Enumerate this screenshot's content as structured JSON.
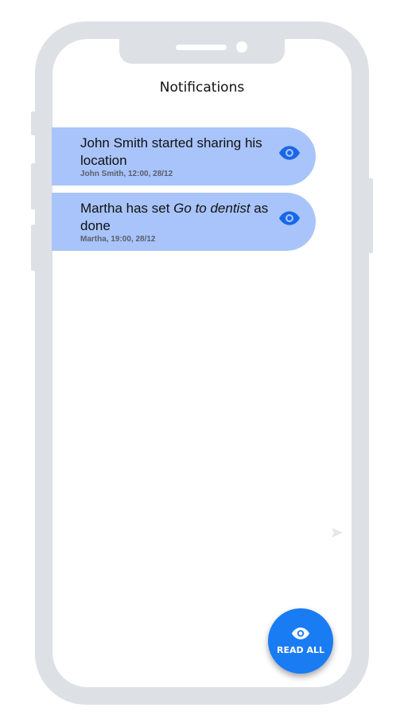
{
  "header": {
    "title": "Notifications"
  },
  "notifications": [
    {
      "message": "John Smith started sharing his location",
      "meta": "John Smith, 12:00, 28/12",
      "icon": "eye-icon"
    },
    {
      "message_prefix": "Martha has set ",
      "message_task": "Go to dentist",
      "message_suffix": " as done",
      "meta": "Martha, 19:00, 28/12",
      "icon": "eye-icon"
    }
  ],
  "fab": {
    "label": "READ ALL",
    "icon": "eye-icon"
  },
  "colors": {
    "card_bg": "#a8c4fb",
    "accent": "#1a7cf2",
    "frame": "#dde0e5"
  }
}
